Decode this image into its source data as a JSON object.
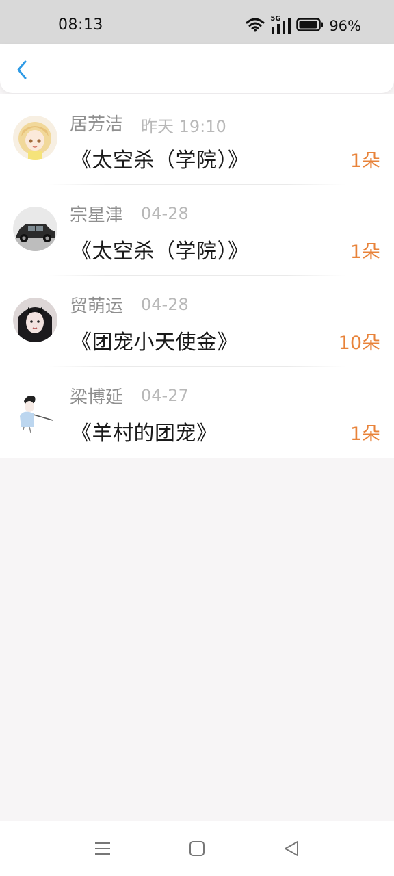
{
  "status_bar": {
    "time": "08:13",
    "network_label": "5G",
    "battery_percent": "96%",
    "battery_level": 0.96,
    "icons": [
      "wifi-icon",
      "signal-icon",
      "battery-icon"
    ]
  },
  "header": {
    "back_icon": "chevron-left-icon",
    "accent_color": "#2f9be6"
  },
  "records": [
    {
      "name": "居芳洁",
      "date": "昨天 19:10",
      "title": "《太空杀（学院）》",
      "count": "1朵",
      "avatar": "anime-girl-avatar"
    },
    {
      "name": "宗星津",
      "date": "04-28",
      "title": "《太空杀（学院）》",
      "count": "1朵",
      "avatar": "vintage-car-avatar"
    },
    {
      "name": "贸萌运",
      "date": "04-28",
      "title": "《团宠小天使金》",
      "count": "10朵",
      "avatar": "girl-portrait-avatar"
    },
    {
      "name": "梁博延",
      "date": "04-27",
      "title": "《羊村的团宠》",
      "count": "1朵",
      "avatar": "sketch-boy-avatar"
    }
  ],
  "colors": {
    "count": "#e8833a",
    "name": "#8f8f8f",
    "date": "#b8b8b8",
    "title": "#1a1a1a",
    "background": "#f7f5f6"
  },
  "nav_bar": {
    "icons": [
      "menu-icon",
      "home-square-icon",
      "back-triangle-icon"
    ]
  }
}
